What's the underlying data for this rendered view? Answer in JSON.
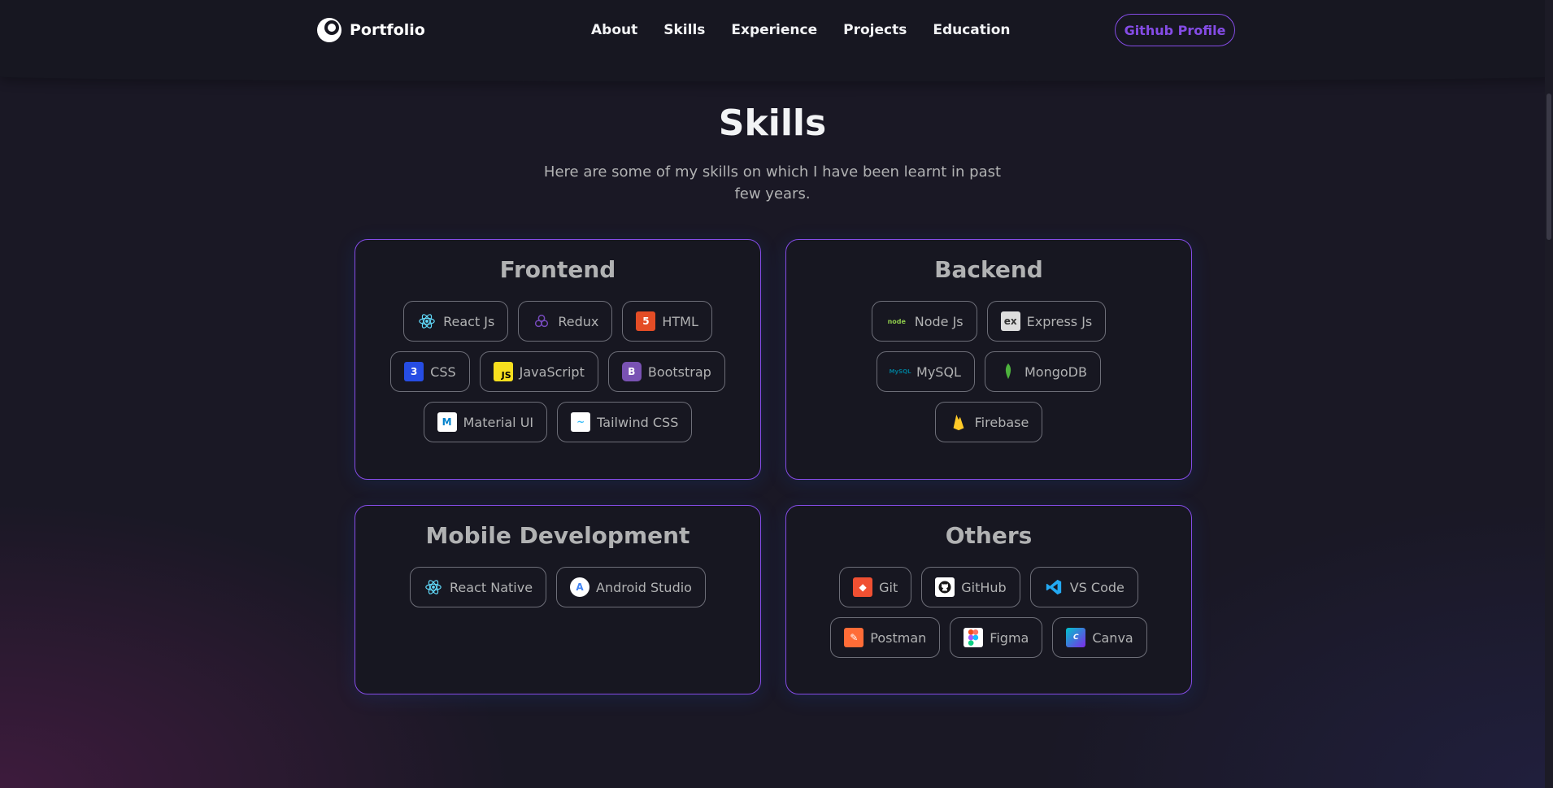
{
  "nav": {
    "logo": "Portfolio",
    "links": [
      "About",
      "Skills",
      "Experience",
      "Projects",
      "Education"
    ],
    "cta": "Github Profile"
  },
  "skills": {
    "title": "Skills",
    "description": "Here are some of my skills on which I have been learnt in past few years.",
    "categories": [
      {
        "title": "Frontend",
        "items": [
          "React Js",
          "Redux",
          "HTML",
          "CSS",
          "JavaScript",
          "Bootstrap",
          "Material UI",
          "Tailwind CSS"
        ]
      },
      {
        "title": "Backend",
        "items": [
          "Node Js",
          "Express Js",
          "MySQL",
          "MongoDB",
          "Firebase"
        ]
      },
      {
        "title": "Mobile Development",
        "items": [
          "React Native",
          "Android Studio"
        ]
      },
      {
        "title": "Others",
        "items": [
          "Git",
          "GitHub",
          "VS Code",
          "Postman",
          "Figma",
          "Canva"
        ]
      }
    ]
  },
  "colors": {
    "accent": "#854ce6",
    "background": "#1a1825",
    "card": "#171721",
    "text_secondary": "#b1b2b3"
  },
  "icons": {
    "frontend": [
      "react-icon",
      "redux-icon",
      "html-icon",
      "css-icon",
      "javascript-icon",
      "bootstrap-icon",
      "material-ui-icon",
      "tailwind-icon"
    ],
    "backend": [
      "nodejs-icon",
      "express-icon",
      "mysql-icon",
      "mongodb-icon",
      "firebase-icon"
    ],
    "mobile": [
      "react-native-icon",
      "android-studio-icon"
    ],
    "others": [
      "git-icon",
      "github-icon",
      "vscode-icon",
      "postman-icon",
      "figma-icon",
      "canva-icon"
    ]
  }
}
